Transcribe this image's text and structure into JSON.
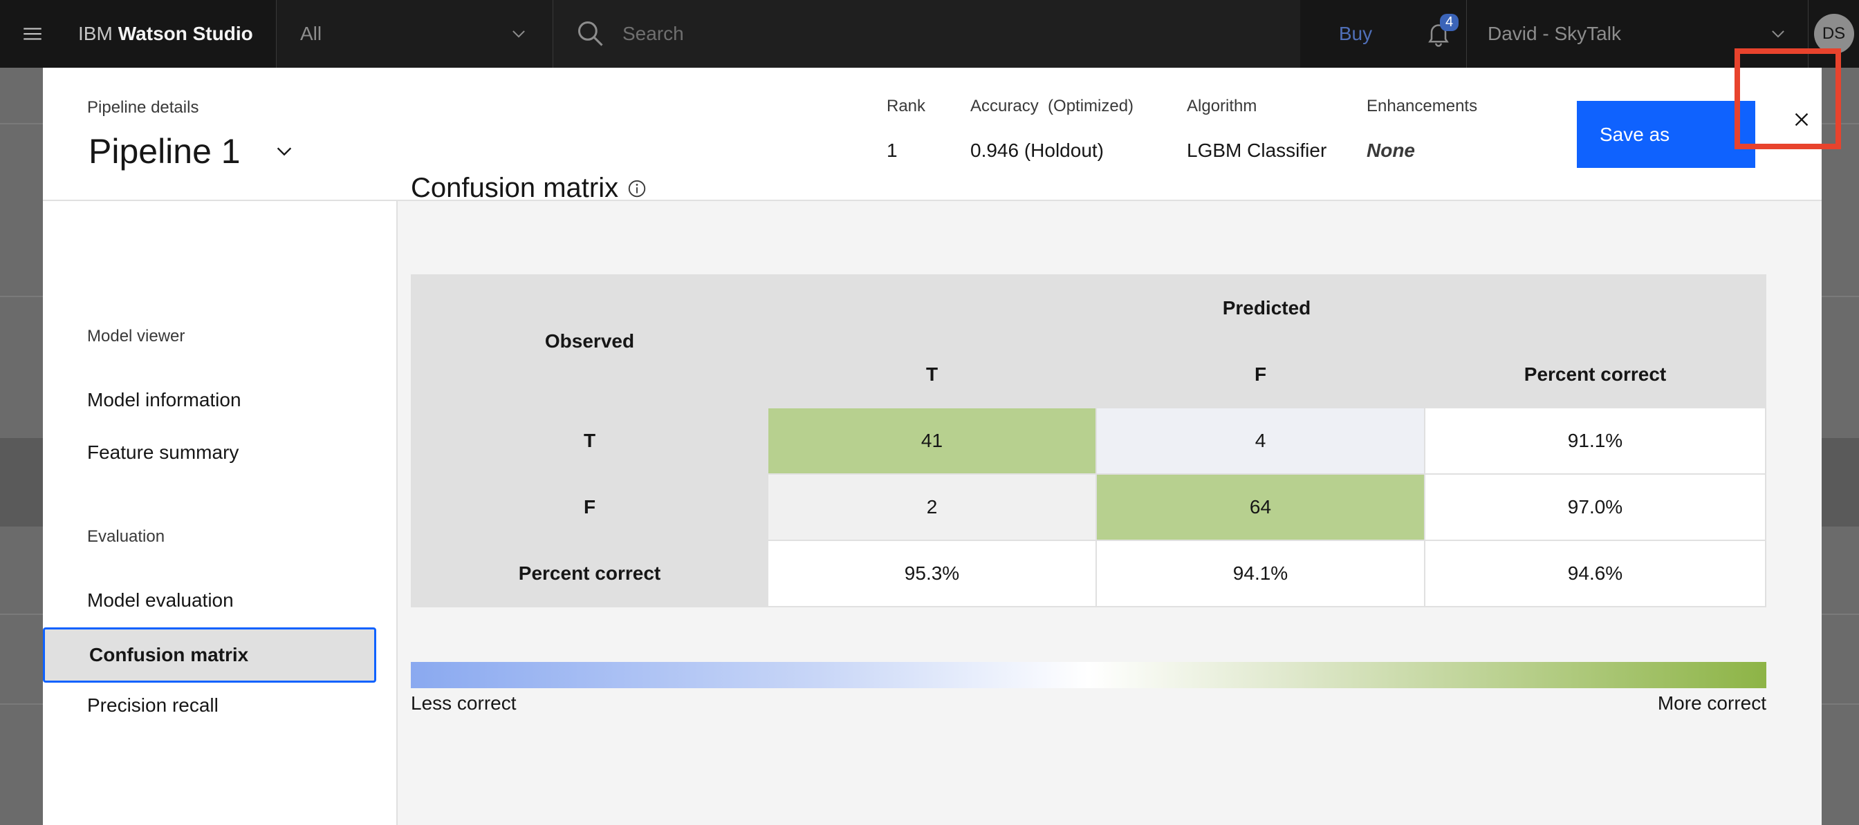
{
  "topbar": {
    "brand_prefix": "IBM",
    "brand_name": "Watson Studio",
    "scope": "All",
    "search_placeholder": "Search",
    "buy": "Buy",
    "notification_count": "4",
    "account": "David - SkyTalk",
    "avatar_initials": "DS"
  },
  "header": {
    "details_label": "Pipeline details",
    "pipeline_name": "Pipeline 1",
    "rank_label": "Rank",
    "rank_value": "1",
    "accuracy_label": "Accuracy  (Optimized)",
    "accuracy_value": "0.946 (Holdout)",
    "algorithm_label": "Algorithm",
    "algorithm_value": "LGBM Classifier",
    "enhancements_label": "Enhancements",
    "enhancements_value": "None",
    "save_as": "Save as"
  },
  "nav": {
    "section_viewer": "Model viewer",
    "model_information": "Model information",
    "feature_summary": "Feature summary",
    "section_evaluation": "Evaluation",
    "model_evaluation": "Model evaluation",
    "confusion_matrix": "Confusion matrix",
    "precision_recall": "Precision recall"
  },
  "matrix": {
    "title": "Confusion matrix",
    "observed": "Observed",
    "predicted": "Predicted",
    "col_t": "T",
    "col_f": "F",
    "col_pct": "Percent correct",
    "rows": [
      {
        "label": "T",
        "t": "41",
        "f": "4",
        "pct": "91.1%"
      },
      {
        "label": "F",
        "t": "2",
        "f": "64",
        "pct": "97.0%"
      },
      {
        "label": "Percent correct",
        "t": "95.3%",
        "f": "94.1%",
        "pct": "94.6%"
      }
    ]
  },
  "legend": {
    "less": "Less correct",
    "more": "More correct"
  },
  "colors": {
    "primary": "#0f62fe",
    "correct_cell": "#b7d08f",
    "highlight": "#e8432d"
  }
}
